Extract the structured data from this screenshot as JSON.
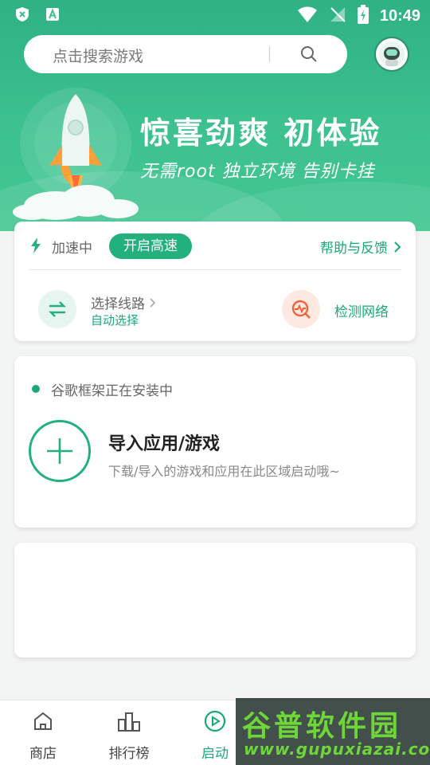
{
  "status_bar": {
    "time": "10:49"
  },
  "search": {
    "placeholder": "点击搜索游戏"
  },
  "banner": {
    "title": "惊喜劲爽 初体验",
    "subtitle": "无需root 独立环境 告别卡挂"
  },
  "speed_card": {
    "status": "加速中",
    "start_button": "开启高速",
    "help_link": "帮助与反馈",
    "route_title": "选择线路",
    "route_sub": "自动选择",
    "detect_label": "检测网络"
  },
  "install_card": {
    "status": "谷歌框架正在安装中",
    "add_title": "导入应用/游戏",
    "add_desc": "下载/导入的游戏和应用在此区域启动哦~"
  },
  "tabs": [
    {
      "label": "商店",
      "icon": "home-icon"
    },
    {
      "label": "排行榜",
      "icon": "ranking-icon"
    },
    {
      "label": "启动",
      "icon": "play-icon",
      "active": true
    }
  ],
  "watermark": {
    "title": "谷普软件园",
    "url": "www.gupuxiazai.com"
  },
  "colors": {
    "accent": "#22b07d",
    "header": "#3cc18f"
  }
}
